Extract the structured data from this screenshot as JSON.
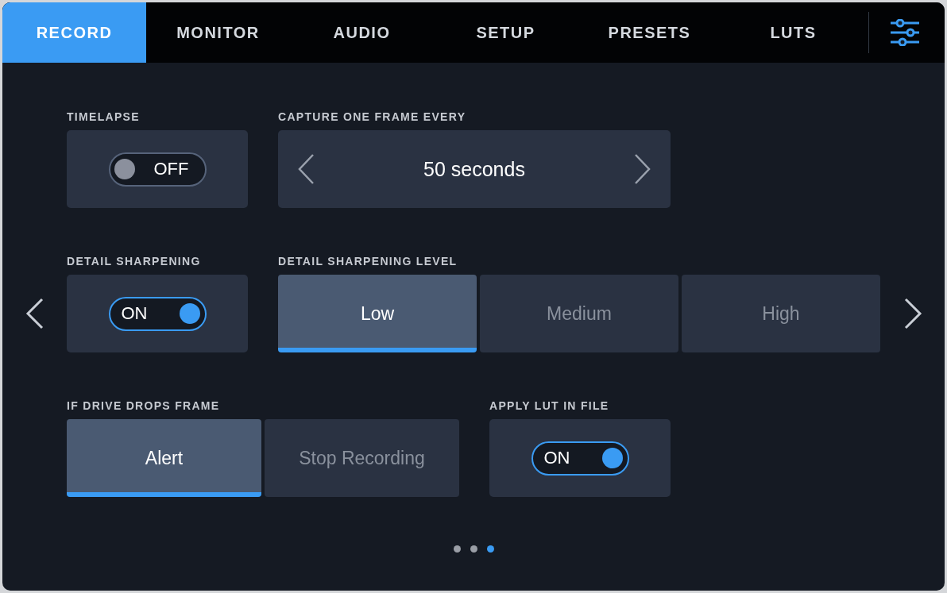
{
  "tabs": [
    {
      "label": "RECORD",
      "selected": true
    },
    {
      "label": "MONITOR",
      "selected": false
    },
    {
      "label": "AUDIO",
      "selected": false
    },
    {
      "label": "SETUP",
      "selected": false
    },
    {
      "label": "PRESETS",
      "selected": false
    },
    {
      "label": "LUTS",
      "selected": false
    }
  ],
  "rows": [
    {
      "fields": [
        {
          "kind": "toggle",
          "label": "TIMELAPSE",
          "on": false,
          "value": "OFF"
        },
        {
          "kind": "stepper",
          "label": "CAPTURE ONE FRAME EVERY",
          "value": "50 seconds"
        }
      ]
    },
    {
      "fields": [
        {
          "kind": "toggle",
          "label": "DETAIL SHARPENING",
          "on": true,
          "value": "ON"
        },
        {
          "kind": "segmented",
          "label": "DETAIL SHARPENING LEVEL",
          "options": [
            {
              "label": "Low",
              "selected": true
            },
            {
              "label": "Medium",
              "selected": false
            },
            {
              "label": "High",
              "selected": false
            }
          ]
        }
      ]
    },
    {
      "fields": [
        {
          "kind": "segmented",
          "label": "IF DRIVE DROPS FRAME",
          "options": [
            {
              "label": "Alert",
              "selected": true
            },
            {
              "label": "Stop Recording",
              "selected": false
            }
          ]
        },
        {
          "kind": "toggle",
          "label": "APPLY LUT IN FILE",
          "on": true,
          "value": "ON"
        }
      ]
    }
  ],
  "page_dots": [
    {
      "selected": false
    },
    {
      "selected": false
    },
    {
      "selected": true
    }
  ]
}
